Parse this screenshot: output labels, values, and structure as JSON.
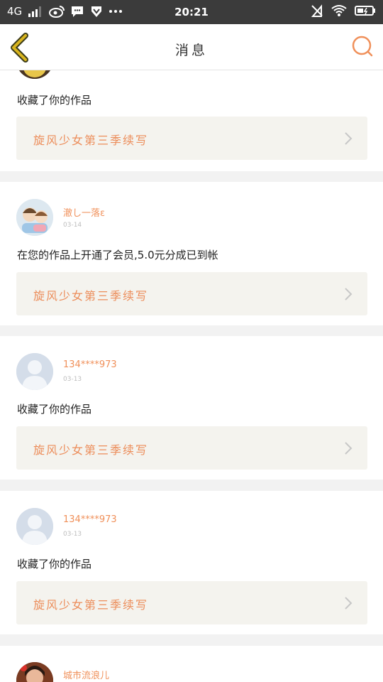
{
  "status_bar": {
    "network": "4G",
    "time": "20:21"
  },
  "header": {
    "title": "消息",
    "back_icon": "chevron-left-icon",
    "search_icon": "search-icon"
  },
  "colors": {
    "accent": "#f0905a",
    "back": "#d9b51e",
    "card_bg": "#f4f3ee"
  },
  "messages": [
    {
      "user": "",
      "date": "",
      "text": "收藏了你的作品",
      "work_title": "旋风少女第三季续写"
    },
    {
      "user": "澈し一落ε",
      "date": "03-14",
      "text": "在您的作品上开通了会员,5.0元分成已到帐",
      "work_title": "旋风少女第三季续写"
    },
    {
      "user": "134****973",
      "date": "03-13",
      "text": "收藏了你的作品",
      "work_title": "旋风少女第三季续写"
    },
    {
      "user": "134****973",
      "date": "03-13",
      "text": "收藏了你的作品",
      "work_title": "旋风少女第三季续写"
    },
    {
      "user": "城市流浪儿",
      "date": "",
      "text": "",
      "work_title": ""
    }
  ]
}
